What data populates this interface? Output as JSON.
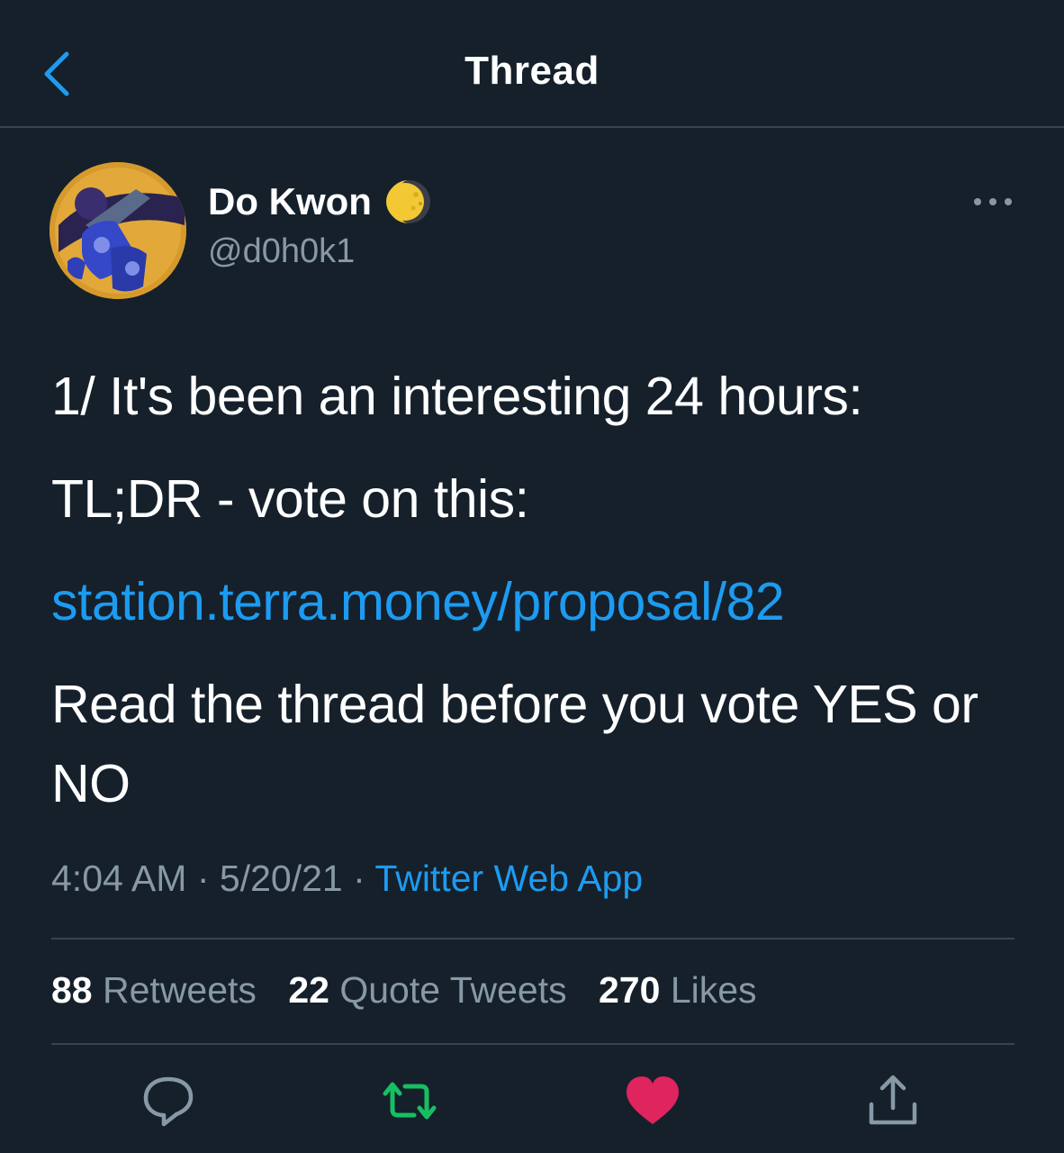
{
  "header": {
    "title": "Thread"
  },
  "tweet": {
    "author": {
      "display_name": "Do Kwon",
      "handle": "@d0h0k1"
    },
    "text": {
      "line1": "1/ It's been an interesting 24 hours:",
      "line2": "TL;DR - vote on this:",
      "link": "station.terra.money/proposal/82",
      "line3": "Read the thread before you vote YES or NO"
    },
    "meta": {
      "time": "4:04 AM",
      "separator": "·",
      "date": "5/20/21",
      "source": "Twitter Web App"
    },
    "stats": {
      "retweets_count": "88",
      "retweets_label": "Retweets",
      "quotes_count": "22",
      "quotes_label": "Quote Tweets",
      "likes_count": "270",
      "likes_label": "Likes"
    }
  },
  "icons": {
    "back": "chevron-left-icon",
    "more": "more-horizontal-icon",
    "reply": "reply-icon",
    "retweet": "retweet-icon",
    "like": "heart-icon",
    "share": "share-icon"
  },
  "colors": {
    "background": "#15202b",
    "accent": "#1d9bf0",
    "secondary_text": "#8899a6",
    "divider": "#38444d",
    "retweet_active": "#17bf63",
    "like_active": "#e0245e"
  }
}
